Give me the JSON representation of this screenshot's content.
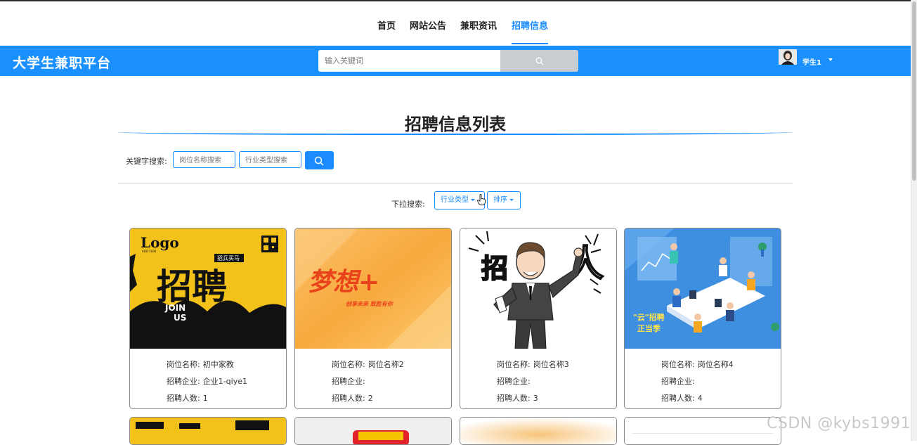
{
  "nav": {
    "items": [
      {
        "label": "首页"
      },
      {
        "label": "网站公告"
      },
      {
        "label": "兼职资讯"
      },
      {
        "label": "招聘信息",
        "active": true
      }
    ]
  },
  "header": {
    "site_title": "大学生兼职平台",
    "search_placeholder": "输入关键词",
    "user_name": "学生1"
  },
  "main": {
    "page_title": "招聘信息列表",
    "keyword_label": "关键字搜索:",
    "position_placeholder": "岗位名称搜索",
    "industry_placeholder": "行业类型搜索",
    "dropdown_label": "下拉搜索:",
    "industry_dropdown": "行业类型",
    "sort_dropdown": "排序"
  },
  "card_labels": {
    "position": "岗位名称:",
    "company": "招聘企业:",
    "count": "招聘人数:"
  },
  "cards": [
    {
      "position": "初中家教",
      "company": "企业1-qiye1",
      "count": "1",
      "image": "zhaopin-poster-black-yellow",
      "image_text": [
        "Logo",
        "ADD SIGN",
        "招兵买马",
        "招聘",
        "JOIN",
        "US"
      ]
    },
    {
      "position": "岗位名称2",
      "company": "",
      "count": "2",
      "image": "dream-plus-poster",
      "image_text": [
        "梦想+",
        "创享未来 致胜有你"
      ]
    },
    {
      "position": "岗位名称3",
      "company": "",
      "count": "3",
      "image": "cartoon-businessman-recruit",
      "image_text": [
        "招",
        "人"
      ]
    },
    {
      "position": "岗位名称4",
      "company": "",
      "count": "4",
      "image": "cloud-recruit-office-illustration",
      "image_text": [
        "\"云\"招聘",
        "正当季"
      ]
    }
  ],
  "watermark": "CSDN @kybs1991",
  "colors": {
    "primary": "#1a8cff",
    "header": "#1a90ff",
    "search_button": "#c9ccd1"
  }
}
